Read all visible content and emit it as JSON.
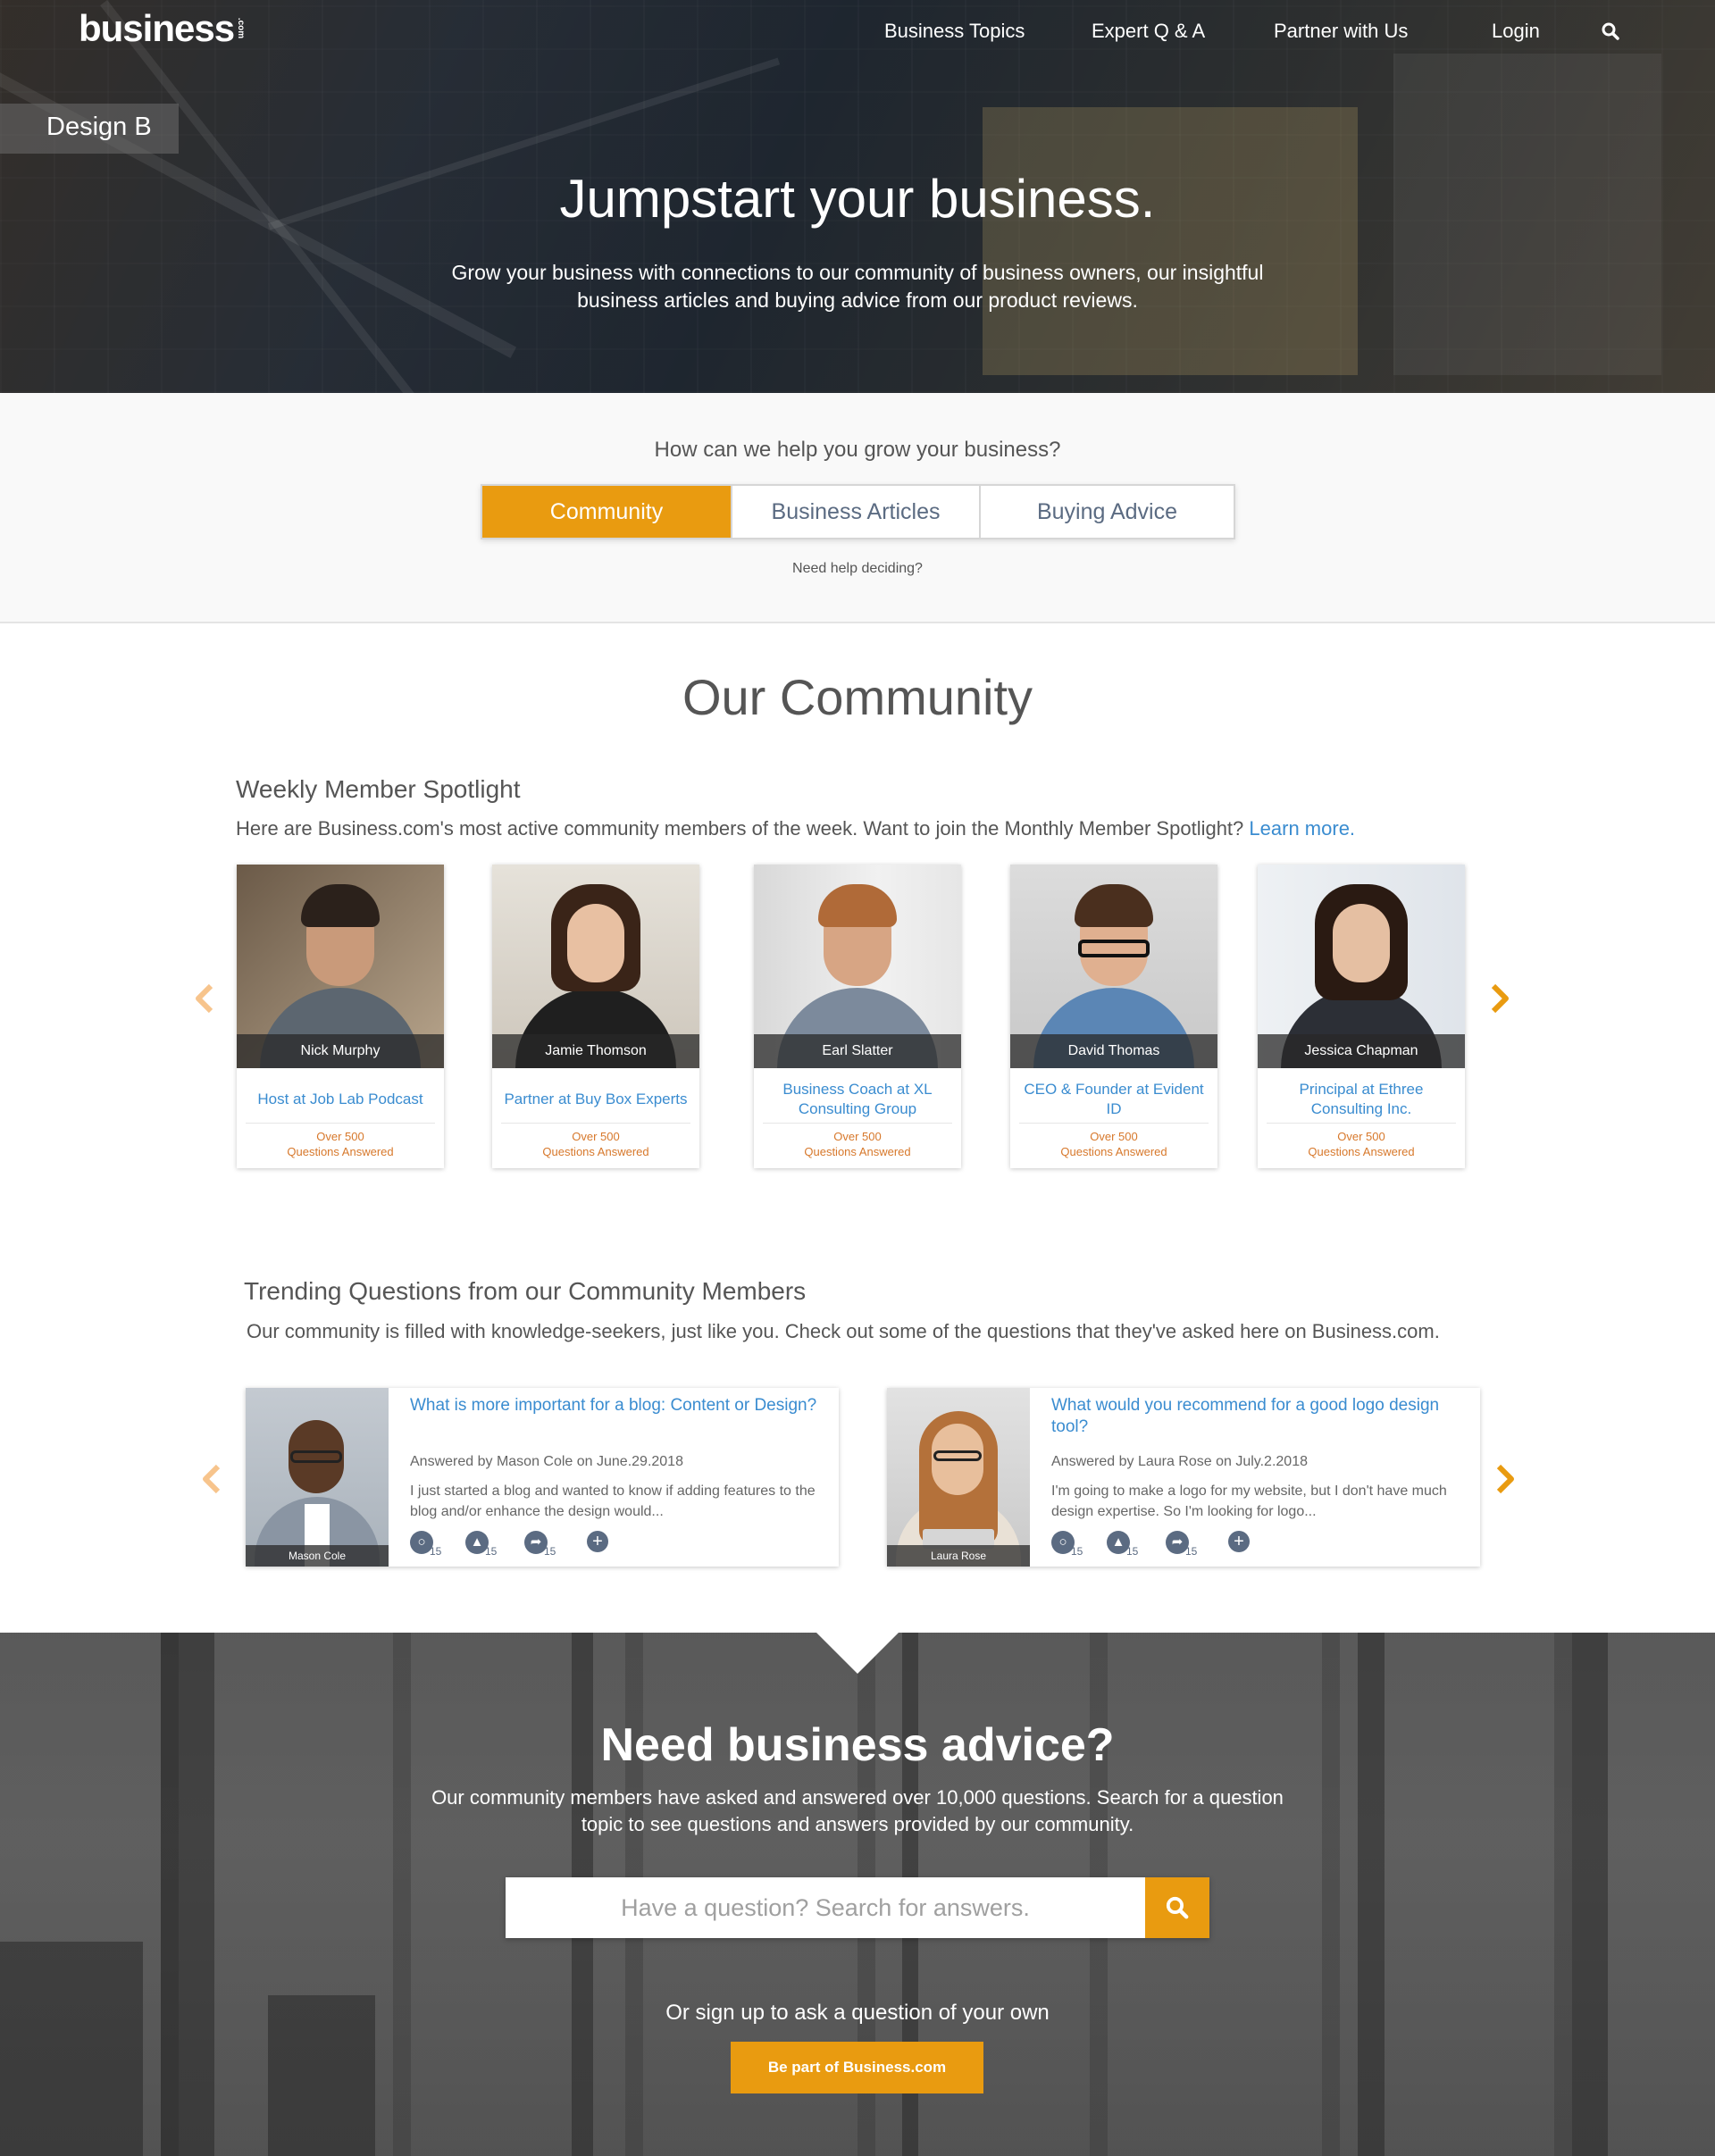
{
  "header": {
    "logo": "business",
    "logo_suffix": ".com",
    "nav": [
      "Business Topics",
      "Expert Q & A",
      "Partner with Us",
      "Login"
    ],
    "search_icon": "search-icon"
  },
  "design_tag": "Design B",
  "hero": {
    "title": "Jumpstart your business.",
    "subtitle": "Grow your business with connections to our community of business owners, our insightful business articles and buying advice from our product reviews."
  },
  "help": {
    "question": "How can we help you grow your business?",
    "tabs": [
      {
        "label": "Community",
        "active": true
      },
      {
        "label": "Business Articles",
        "active": false
      },
      {
        "label": "Buying Advice",
        "active": false
      }
    ],
    "link": "Need help deciding?"
  },
  "community": {
    "title": "Our Community",
    "spotlight_heading": "Weekly Member Spotlight",
    "spotlight_text": "Here are Business.com's most active community members of the week. Want to join the Monthly Member Spotlight?",
    "spotlight_link": "Learn more.",
    "members": [
      {
        "name": "Nick Murphy",
        "role": "Host at Job Lab Podcast",
        "stat_1": "Over 500",
        "stat_2": "Questions Answered"
      },
      {
        "name": "Jamie Thomson",
        "role": "Partner at Buy Box Experts",
        "stat_1": "Over 500",
        "stat_2": "Questions Answered"
      },
      {
        "name": "Earl Slatter",
        "role": "Business Coach at XL Consulting Group",
        "stat_1": "Over 500",
        "stat_2": "Questions Answered"
      },
      {
        "name": "David Thomas",
        "role": "CEO & Founder at Evident ID",
        "stat_1": "Over 500",
        "stat_2": "Questions Answered"
      },
      {
        "name": "Jessica Chapman",
        "role": "Principal at Ethree Consulting Inc.",
        "stat_1": "Over 500",
        "stat_2": "Questions Answered"
      }
    ],
    "trending_heading": "Trending Questions from our Community Members",
    "trending_text": "Our community is filled with knowledge-seekers, just like you. Check out some of the questions that they've asked here on Business.com.",
    "questions": [
      {
        "name": "Mason Cole",
        "title": "What is more important for a blog: Content or Design?",
        "meta": "Answered by Mason Cole on June.29.2018",
        "body": "I just started a blog and wanted to know if adding features to the blog and/or enhance the design would...",
        "counts": [
          "15",
          "15",
          "15"
        ]
      },
      {
        "name": "Laura Rose",
        "title": "What would you recommend for a good logo design tool?",
        "meta": "Answered by Laura Rose on July.2.2018",
        "body": "I'm going to make a logo for my website, but I don't have much design expertise. So I'm looking for logo...",
        "counts": [
          "15",
          "15",
          "15"
        ]
      }
    ]
  },
  "cta": {
    "title": "Need business advice?",
    "subtitle": "Our community members have asked and answered over 10,000 questions. Search for a question topic to see questions and answers provided by our community.",
    "search_placeholder": "Have a question? Search for answers.",
    "or_text": "Or sign up to ask a question of your own",
    "button": "Be part of Business.com"
  },
  "colors": {
    "accent": "#e99b10",
    "link": "#3a8cd0",
    "stat": "#d7782b",
    "icon_gray": "#5b6b82"
  }
}
